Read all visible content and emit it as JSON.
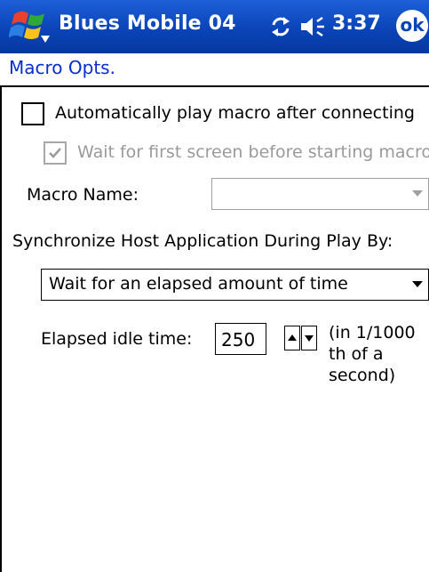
{
  "window": {
    "title": "Blues Mobile 04",
    "time": "3:37",
    "ok_label": "ok",
    "icons": [
      "start-menu-flag-icon",
      "sync-icon",
      "speaker-volume-icon"
    ],
    "colors": {
      "titlebar": "#0a44b8",
      "page_title": "#0a2dd0",
      "disabled_text": "#9a9a9a"
    }
  },
  "page": {
    "title": "Macro Opts."
  },
  "form": {
    "auto_play": {
      "label": "Automatically play macro after connecting",
      "checked": false,
      "enabled": true
    },
    "wait_first_screen": {
      "label": "Wait for first screen before starting macro",
      "checked": true,
      "enabled": false
    },
    "macro_name": {
      "label": "Macro Name:",
      "value": "",
      "enabled": false
    },
    "sync_label": "Synchronize Host Application During Play By:",
    "sync_method": {
      "value": "Wait for an elapsed amount of time"
    },
    "idle_time": {
      "label": "Elapsed idle time:",
      "value": "250",
      "units_lines": [
        "(in 1/1000",
        "th of a",
        "second)"
      ]
    }
  }
}
